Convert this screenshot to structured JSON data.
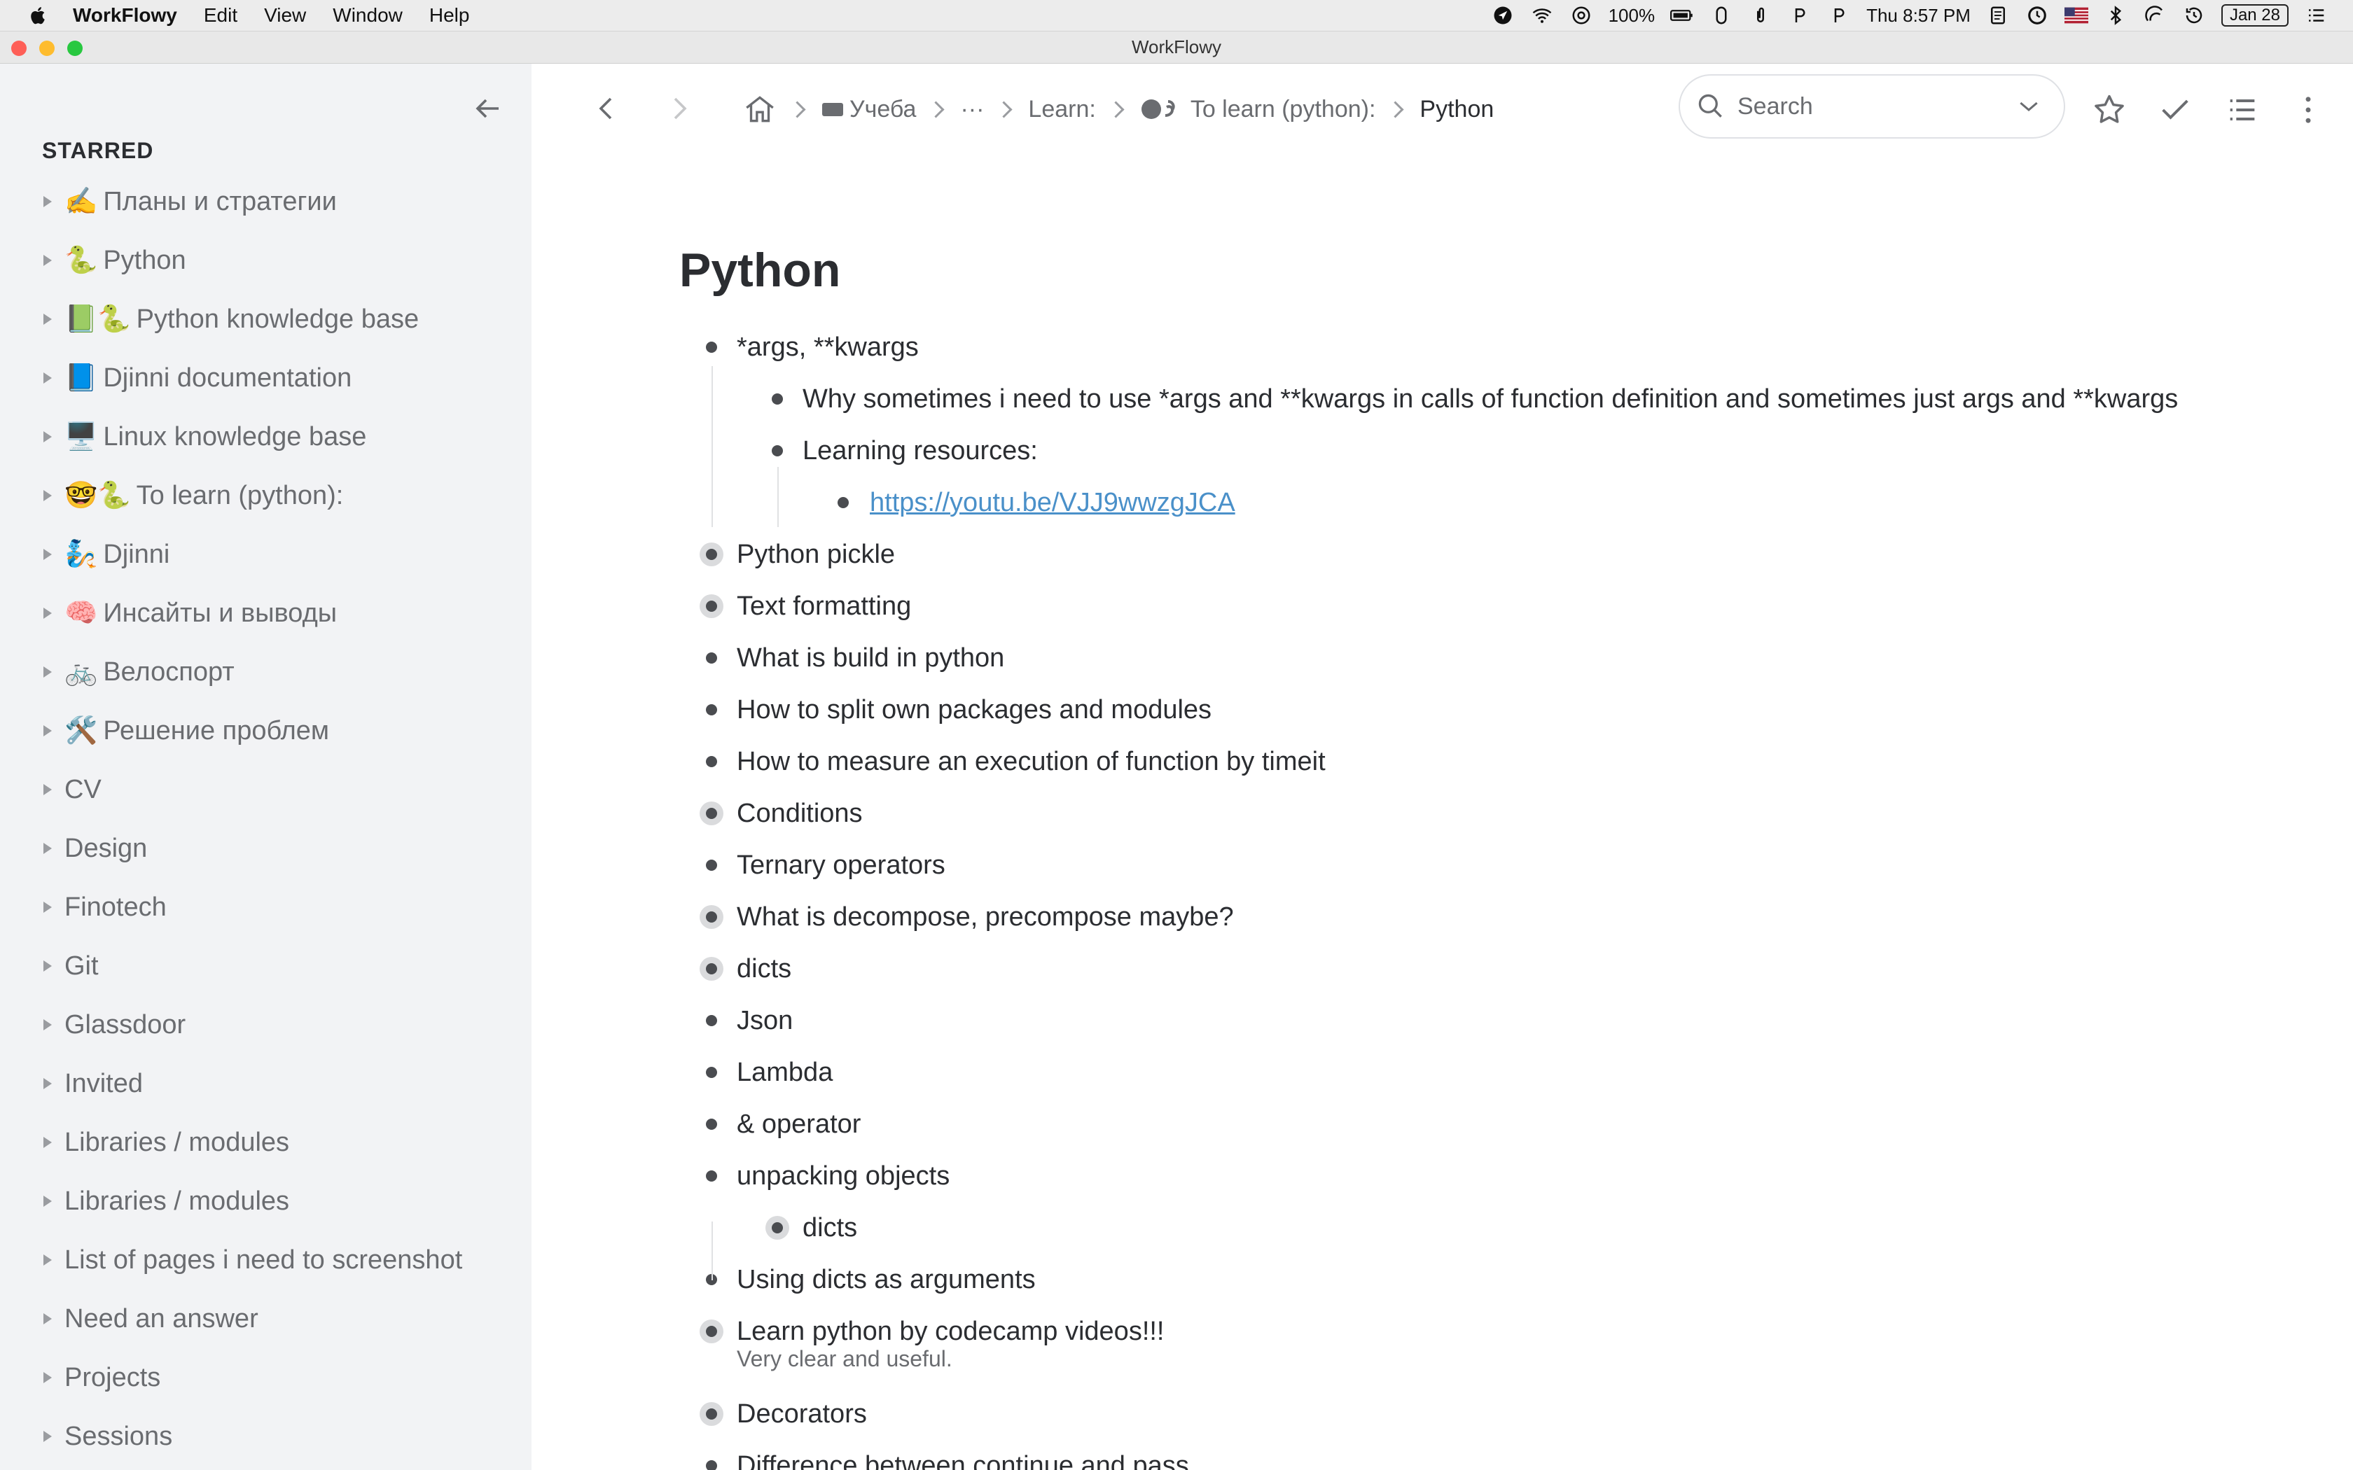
{
  "menubar": {
    "app_name": "WorkFlowy",
    "menus": [
      "Edit",
      "View",
      "Window",
      "Help"
    ],
    "battery": "100%",
    "clock": "Thu 8:57 PM",
    "date_badge": "Jan 28"
  },
  "window": {
    "title": "WorkFlowy"
  },
  "sidebar": {
    "heading": "STARRED",
    "items": [
      {
        "emoji": "✍️",
        "label": "Планы и стратегии"
      },
      {
        "emoji": "🐍",
        "label": "Python"
      },
      {
        "emoji": "📗🐍",
        "label": "Python knowledge base"
      },
      {
        "emoji": "📘",
        "label": "Djinni documentation"
      },
      {
        "emoji": "🖥️",
        "label": "Linux knowledge base"
      },
      {
        "emoji": "🤓🐍",
        "label": "To learn (python):"
      },
      {
        "emoji": "🧞",
        "label": "Djinni"
      },
      {
        "emoji": "🧠",
        "label": "Инсайты и выводы"
      },
      {
        "emoji": "🚲",
        "label": "Велоспорт"
      },
      {
        "emoji": "🛠️",
        "label": "Решение проблем"
      },
      {
        "emoji": "",
        "label": "CV"
      },
      {
        "emoji": "",
        "label": "Design"
      },
      {
        "emoji": "",
        "label": "Finotech"
      },
      {
        "emoji": "",
        "label": "Git"
      },
      {
        "emoji": "",
        "label": "Glassdoor"
      },
      {
        "emoji": "",
        "label": "Invited"
      },
      {
        "emoji": "",
        "label": "Libraries / modules"
      },
      {
        "emoji": "",
        "label": "Libraries / modules"
      },
      {
        "emoji": "",
        "label": "List of pages i need to screenshot"
      },
      {
        "emoji": "",
        "label": "Need an answer"
      },
      {
        "emoji": "",
        "label": "Projects"
      },
      {
        "emoji": "",
        "label": "Sessions"
      }
    ]
  },
  "breadcrumb": {
    "items": [
      {
        "label": "Учеба"
      },
      {
        "label": "···"
      },
      {
        "label": "Learn:"
      },
      {
        "label": "To learn (python):"
      }
    ],
    "current": "Python"
  },
  "search": {
    "placeholder": "Search"
  },
  "page": {
    "title": "Python"
  },
  "outline": [
    {
      "text": "*args, **kwargs",
      "level": 0,
      "collapsed": false
    },
    {
      "text": "Why sometimes i need to use *args and **kwargs in calls of function definition and sometimes just args and **kwargs",
      "level": 1,
      "collapsed": false
    },
    {
      "text": "Learning resources:",
      "level": 1,
      "collapsed": false
    },
    {
      "text": "https://youtu.be/VJJ9wwzgJCA",
      "level": 2,
      "collapsed": false,
      "link": true
    },
    {
      "text": "Python pickle",
      "level": 0,
      "collapsed": true
    },
    {
      "text": "Text formatting",
      "level": 0,
      "collapsed": true
    },
    {
      "text": "What is build in python",
      "level": 0,
      "collapsed": false
    },
    {
      "text": "How to split own packages and modules",
      "level": 0,
      "collapsed": false
    },
    {
      "text": "How to measure an execution of function by timeit",
      "level": 0,
      "collapsed": false
    },
    {
      "text": "Conditions",
      "level": 0,
      "collapsed": true
    },
    {
      "text": "Ternary operators",
      "level": 0,
      "collapsed": false
    },
    {
      "text": "What is decompose, precompose maybe?",
      "level": 0,
      "collapsed": true
    },
    {
      "text": "dicts",
      "level": 0,
      "collapsed": true
    },
    {
      "text": "Json",
      "level": 0,
      "collapsed": false
    },
    {
      "text": "Lambda",
      "level": 0,
      "collapsed": false
    },
    {
      "text": "& operator",
      "level": 0,
      "collapsed": false
    },
    {
      "text": "unpacking objects",
      "level": 0,
      "collapsed": false
    },
    {
      "text": "dicts",
      "level": 1,
      "collapsed": true
    },
    {
      "text": "Using dicts as arguments",
      "level": 0,
      "collapsed": false
    },
    {
      "text": "Learn python by codecamp videos!!!",
      "level": 0,
      "collapsed": true,
      "note": "Very clear and useful."
    },
    {
      "text": "Decorators",
      "level": 0,
      "collapsed": true
    },
    {
      "text": "Difference between continue and pass",
      "level": 0,
      "collapsed": false
    }
  ],
  "colors": {
    "sidebar_bg": "#f2f3f5",
    "link": "#4a90c9",
    "text": "#2b2d31",
    "muted": "#6a6c70"
  }
}
